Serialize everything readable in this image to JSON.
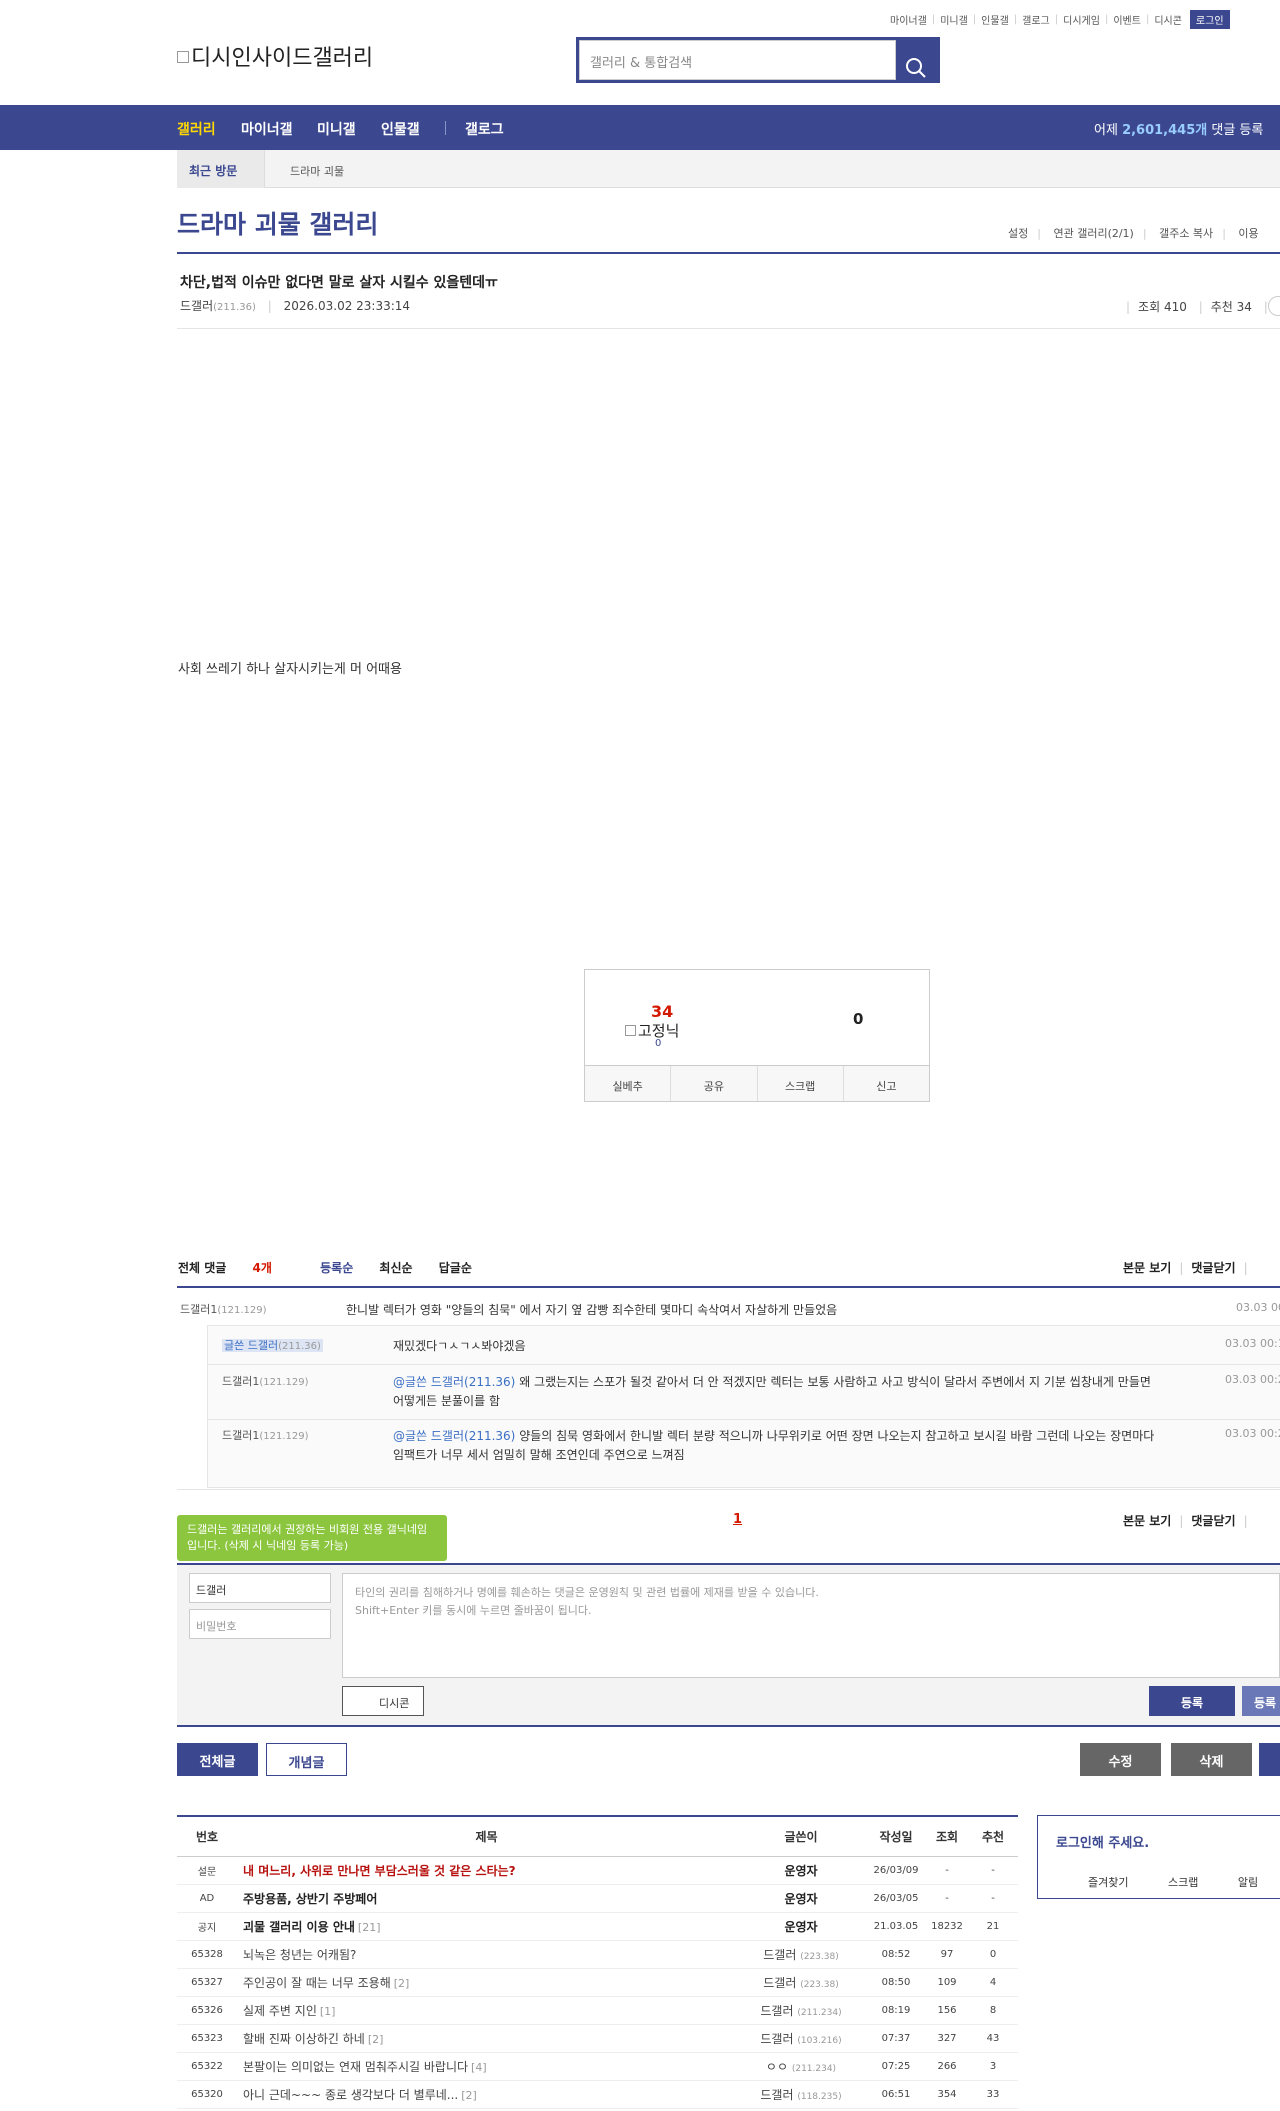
{
  "util_menu": [
    "마이너갤",
    "미니갤",
    "인물갤",
    "갤로그",
    "디시게임",
    "이벤트",
    "디시콘"
  ],
  "login_label": "로그인",
  "logo_alt": "디시인사이드갤러리",
  "search_placeholder": "갤러리 & 통합검색",
  "gnb": {
    "items": [
      "갤러리",
      "마이너갤",
      "미니갤",
      "인물갤",
      "갤로그"
    ],
    "stat_prefix": "어제",
    "stat_value": "2,601,445개",
    "stat_suffix": "댓글 등록"
  },
  "recent": {
    "label": "최근 방문",
    "item": "드라마 괴물"
  },
  "gallery": {
    "title": "드라마 괴물 갤러리",
    "tools": [
      "설정",
      "연관 갤러리(2/1)",
      "갤주소 복사",
      "이용"
    ]
  },
  "post": {
    "title": "차단,법적 이슈만 없다면 말로 살자 시킬수 있을텐데ㅠ",
    "author": "드갤러",
    "ip": "(211.36)",
    "date": "2026.03.02 23:33:14",
    "views": "조회 410",
    "recommends": "추천 34",
    "body": "사회 쓰레기 하나 살자시키는게 머 어때용"
  },
  "recommend_box": {
    "up": "34",
    "fixed_nick": "고정닉",
    "fixed_count": "0",
    "down": "0",
    "buttons": [
      "실베추",
      "공유",
      "스크랩",
      "신고"
    ]
  },
  "comments_header": {
    "total_label": "전체 댓글",
    "total_count": "4개",
    "sorts": [
      "등록순",
      "최신순",
      "답글순"
    ],
    "tools": [
      "본문 보기",
      "댓글닫기"
    ]
  },
  "comments": [
    {
      "nick": "드갤러1",
      "ip": "(121.129)",
      "text": "한니발 렉터가 영화 \"양들의 침묵\" 에서 자기 옆 감빵 죄수한테 몇마디 속삭여서 자살하게 만들었음",
      "date": "03.03 00:"
    },
    {
      "nick": "글쓴 드갤러",
      "ip": "(211.36)",
      "text": "재밌겠다ㄱㅅㄱㅅ봐야겠음",
      "date": "03.03 00:1"
    },
    {
      "nick": "드갤러1",
      "ip": "(121.129)",
      "mention": "@글쓴 드갤러(211.36)",
      "text": " 왜 그랬는지는 스포가 될것 같아서 더 안 적겠지만 렉터는 보통 사람하고 사고 방식이 달라서 주변에서 지 기분 씹창내게 만들면 어떻게든 분풀이를 함",
      "date": "03.03 00:2"
    },
    {
      "nick": "드갤러1",
      "ip": "(121.129)",
      "mention": "@글쓴 드갤러(211.36)",
      "text": " 양들의 침묵 영화에서 한니발 렉터 분량 적으니까 나무위키로 어떤 장면 나오는지 참고하고 보시길 바람 그런데 나오는 장면마다 임팩트가 너무 세서 엄밀히 말해 조연인데 주연으로 느껴짐",
      "date": "03.03 00:2"
    }
  ],
  "pager": "1",
  "write": {
    "tip": "드갤러는 갤러리에서 권장하는 비회원 전용 갤닉네임입니다. (삭제 시 닉네임 등록 가능)",
    "nick": "드갤러",
    "password_placeholder": "비밀번호",
    "textarea_notice": "타인의 권리를 침해하거나 명예를 훼손하는 댓글은 운영원칙 및 관련 법률에 제재를 받을 수 있습니다.",
    "textarea_hint": "Shift+Enter 키를 동시에 누르면 줄바꿈이 됩니다.",
    "dccon": "디시콘",
    "submit": "등록",
    "submit2": "등록"
  },
  "bottom_buttons": {
    "all": "전체글",
    "concept": "개념글",
    "edit": "수정",
    "delete": "삭제"
  },
  "list": {
    "headers": [
      "번호",
      "제목",
      "글쓴이",
      "작성일",
      "조회",
      "추천"
    ],
    "rows": [
      {
        "no": "설문",
        "title": "내 며느리, 사위로 만나면 부담스러울 것 같은 스타는?",
        "replies": "",
        "writer": "운영자",
        "ip": "",
        "date": "26/03/09",
        "views": "-",
        "rec": "-",
        "style": "red"
      },
      {
        "no": "AD",
        "title": "주방용품, 상반기 주방페어",
        "replies": "",
        "writer": "운영자",
        "ip": "",
        "date": "26/03/05",
        "views": "-",
        "rec": "-",
        "style": "bold"
      },
      {
        "no": "공지",
        "title": "괴물 갤러리 이용 안내",
        "replies": "[21]",
        "writer": "운영자",
        "ip": "",
        "date": "21.03.05",
        "views": "18232",
        "rec": "21",
        "style": "bold"
      },
      {
        "no": "65328",
        "title": "뇌녹은 청년는 어캐됨?",
        "replies": "",
        "writer": "드갤러",
        "ip": "(223.38)",
        "date": "08:52",
        "views": "97",
        "rec": "0",
        "style": ""
      },
      {
        "no": "65327",
        "title": "주인공이 잘 때는 너무 조용해",
        "replies": "[2]",
        "writer": "드갤러",
        "ip": "(223.38)",
        "date": "08:50",
        "views": "109",
        "rec": "4",
        "style": ""
      },
      {
        "no": "65326",
        "title": "실제 주변 지인",
        "replies": "[1]",
        "writer": "드갤러",
        "ip": "(211.234)",
        "date": "08:19",
        "views": "156",
        "rec": "8",
        "style": ""
      },
      {
        "no": "65323",
        "title": "할배 진짜 이상하긴 하네",
        "replies": "[2]",
        "writer": "드갤러",
        "ip": "(103.216)",
        "date": "07:37",
        "views": "327",
        "rec": "43",
        "style": ""
      },
      {
        "no": "65322",
        "title": "본팔이는 의미없는 연재 멈춰주시길 바랍니다",
        "replies": "[4]",
        "writer": "ㅇㅇ",
        "ip": "(211.234)",
        "date": "07:25",
        "views": "266",
        "rec": "3",
        "style": ""
      },
      {
        "no": "65320",
        "title": "아니 근데~~~ 종로 생각보다 더 별루네...",
        "replies": "[2]",
        "writer": "드갤러",
        "ip": "(118.235)",
        "date": "06:51",
        "views": "354",
        "rec": "33",
        "style": ""
      }
    ]
  },
  "side": {
    "login_prompt": "로그인해 주세요.",
    "links": [
      "즐겨찾기",
      "스크랩",
      "알림"
    ]
  },
  "colors": {
    "brand": "#3b4890",
    "accent_red": "#d31900",
    "tip_green": "#8cc63f"
  }
}
